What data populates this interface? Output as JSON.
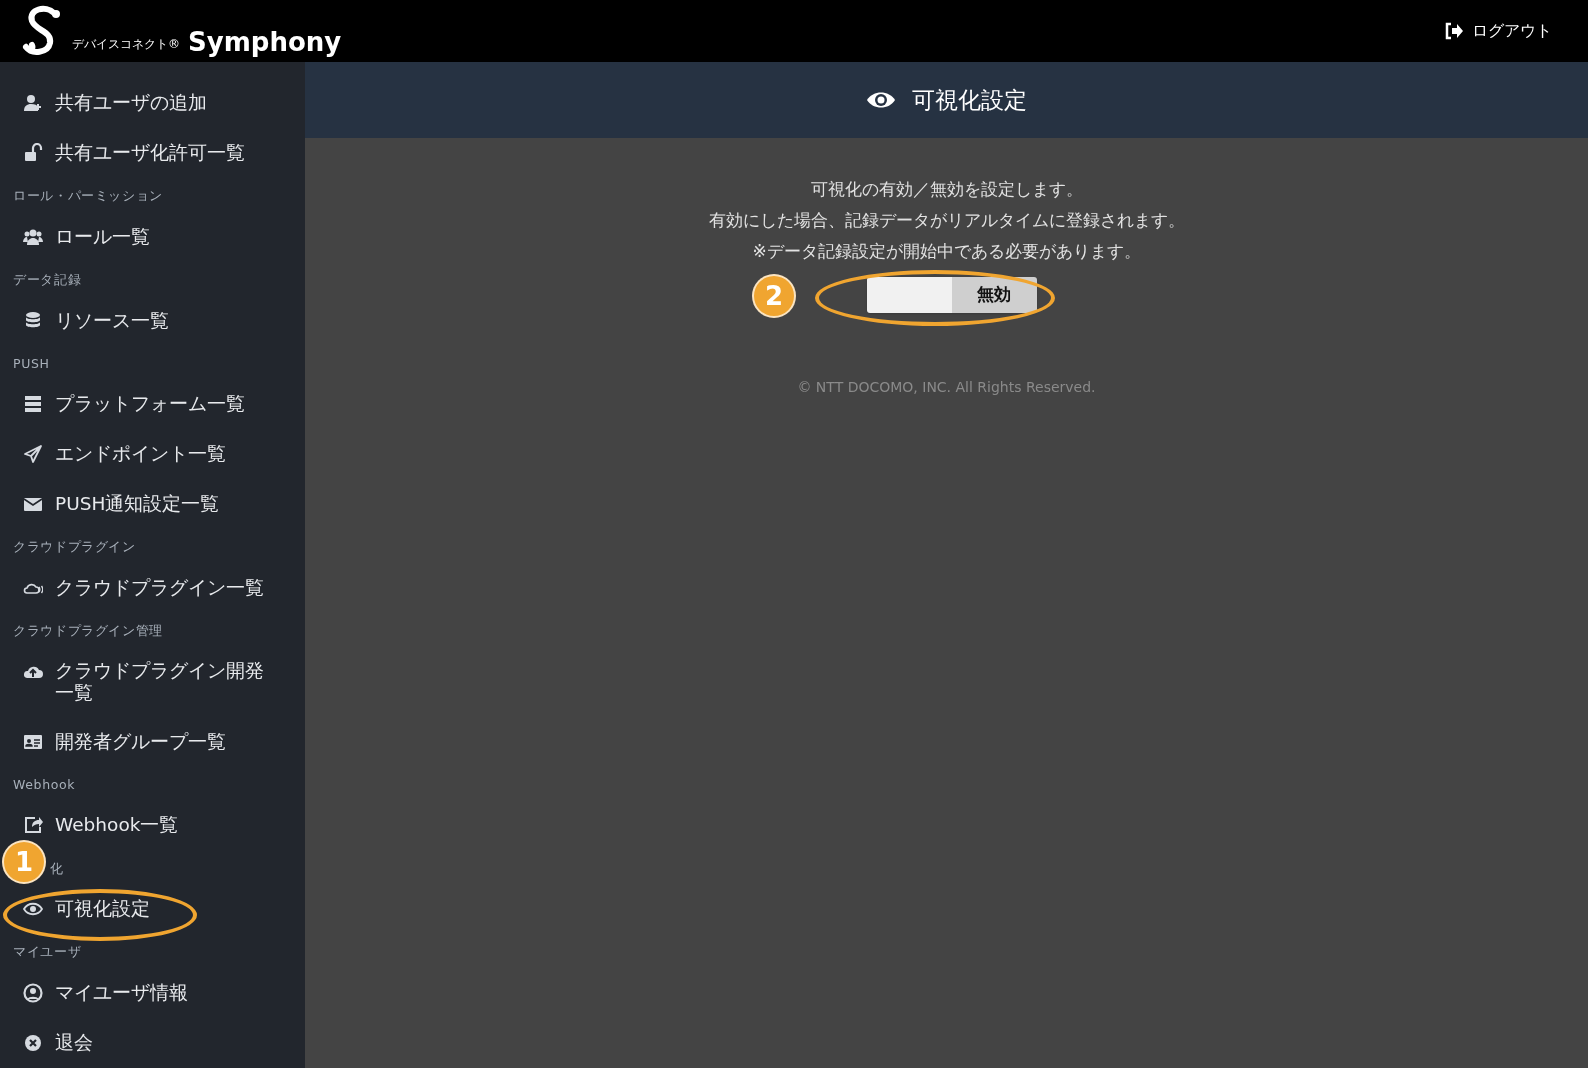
{
  "header": {
    "brand_sub": "デバイスコネクト®",
    "brand": "Symphony",
    "logout": "ログアウト"
  },
  "sidebar": [
    {
      "kind": "item",
      "label": "共有ユーザの追加"
    },
    {
      "kind": "item",
      "label": "共有ユーザ化許可一覧"
    },
    {
      "kind": "section",
      "label": "ロール・パーミッション"
    },
    {
      "kind": "item",
      "label": "ロール一覧"
    },
    {
      "kind": "section",
      "label": "データ記録"
    },
    {
      "kind": "item",
      "label": "リソース一覧"
    },
    {
      "kind": "section",
      "label": "PUSH"
    },
    {
      "kind": "item",
      "label": "プラットフォーム一覧"
    },
    {
      "kind": "item",
      "label": "エンドポイント一覧"
    },
    {
      "kind": "item",
      "label": "PUSH通知設定一覧"
    },
    {
      "kind": "section",
      "label": "クラウドプラグイン"
    },
    {
      "kind": "item",
      "label": "クラウドプラグイン一覧"
    },
    {
      "kind": "section",
      "label": "クラウドプラグイン管理"
    },
    {
      "kind": "item",
      "label": "クラウドプラグイン開発一覧"
    },
    {
      "kind": "item",
      "label": "開発者グループ一覧"
    },
    {
      "kind": "section",
      "label": "Webhook"
    },
    {
      "kind": "item",
      "label": "Webhook一覧"
    },
    {
      "kind": "section",
      "label": "化"
    },
    {
      "kind": "item",
      "label": "可視化設定"
    },
    {
      "kind": "section",
      "label": "マイユーザ"
    },
    {
      "kind": "item",
      "label": "マイユーザ情報"
    },
    {
      "kind": "item",
      "label": "退会"
    }
  ],
  "page": {
    "title": "可視化設定",
    "description": [
      "可視化の有効／無効を設定します。",
      "有効にした場合、記録データがリアルタイムに登録されます。",
      "※データ記録設定が開始中である必要があります。"
    ],
    "toggle": {
      "on": false,
      "label": "無効"
    },
    "footer": "© NTT DOCOMO, INC. All Rights Reserved."
  },
  "annotations": [
    {
      "number": "1"
    },
    {
      "number": "2"
    }
  ]
}
